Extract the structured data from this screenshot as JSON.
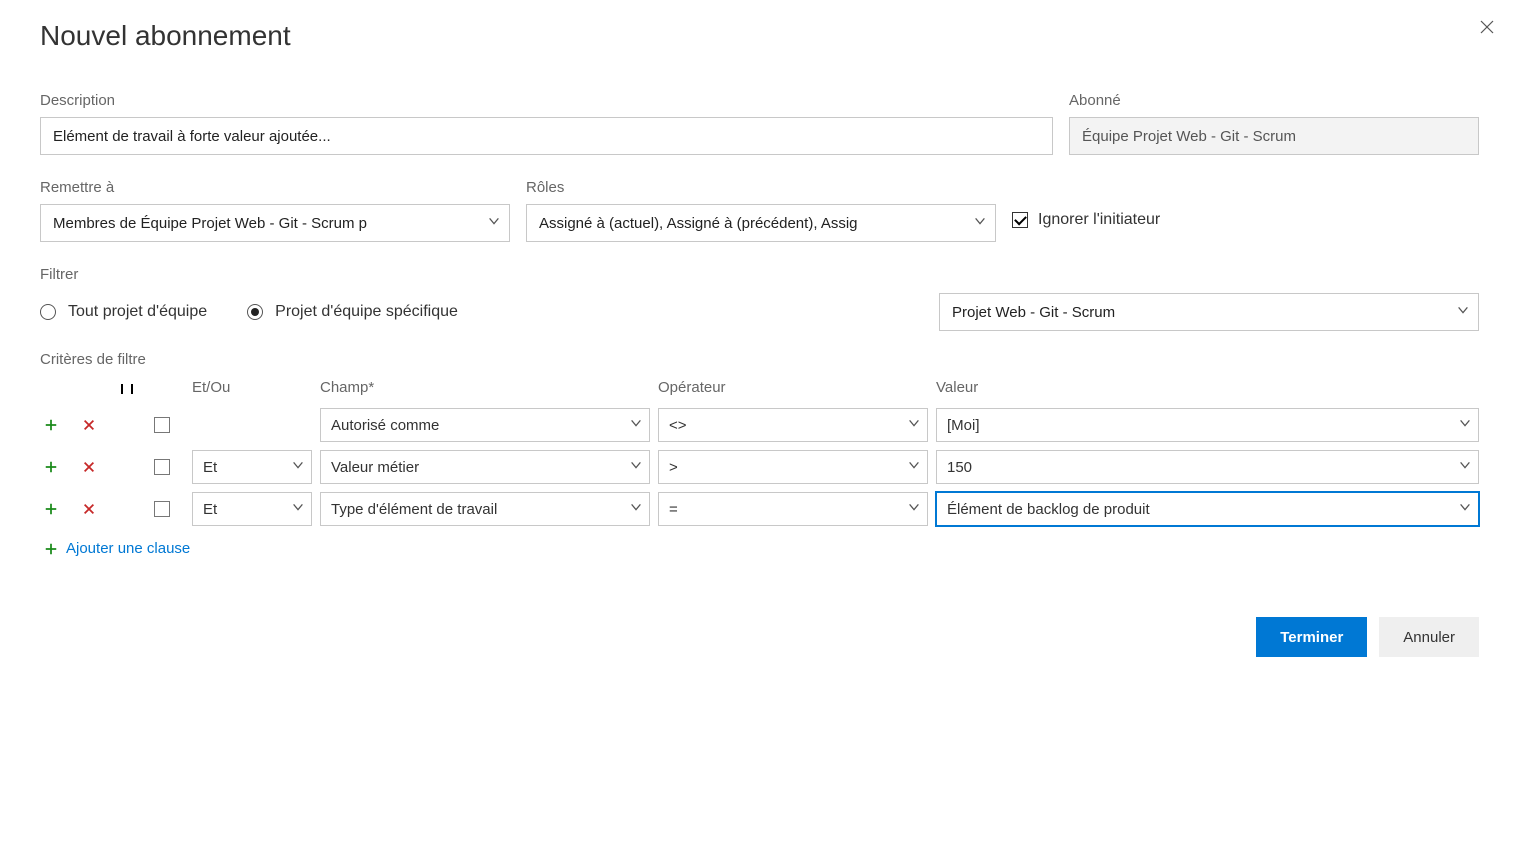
{
  "dialog": {
    "title": "Nouvel abonnement"
  },
  "labels": {
    "description": "Description",
    "subscriber": "Abonné",
    "deliver_to": "Remettre à",
    "roles": "Rôles",
    "ignore_initiator": "Ignorer l'initiateur",
    "filter": "Filtrer",
    "filter_all": "Tout projet d'équipe",
    "filter_specific": "Projet d'équipe spécifique",
    "filter_criteria": "Critères de filtre",
    "and_or": "Et/Ou",
    "field": "Champ*",
    "operator": "Opérateur",
    "value": "Valeur",
    "add_clause": "Ajouter une clause"
  },
  "values": {
    "description": "Elément de travail à forte valeur ajoutée...",
    "subscriber": "Équipe Projet Web - Git - Scrum",
    "deliver_to": "Membres de Équipe Projet Web - Git - Scrum p",
    "roles": "Assigné à (actuel), Assigné à (précédent), Assig",
    "ignore_initiator_checked": true,
    "filter_mode": "specific",
    "project": "Projet Web - Git - Scrum"
  },
  "criteria": [
    {
      "and_or": "",
      "field": "Autorisé comme",
      "operator": "<>",
      "value": "[Moi]",
      "focused": false,
      "show_andor": false
    },
    {
      "and_or": "Et",
      "field": "Valeur métier",
      "operator": ">",
      "value": "150",
      "focused": false,
      "show_andor": true
    },
    {
      "and_or": "Et",
      "field": "Type d'élément de travail",
      "operator": "=",
      "value": "Élément de backlog de produit",
      "focused": true,
      "show_andor": true
    }
  ],
  "buttons": {
    "finish": "Terminer",
    "cancel": "Annuler"
  }
}
